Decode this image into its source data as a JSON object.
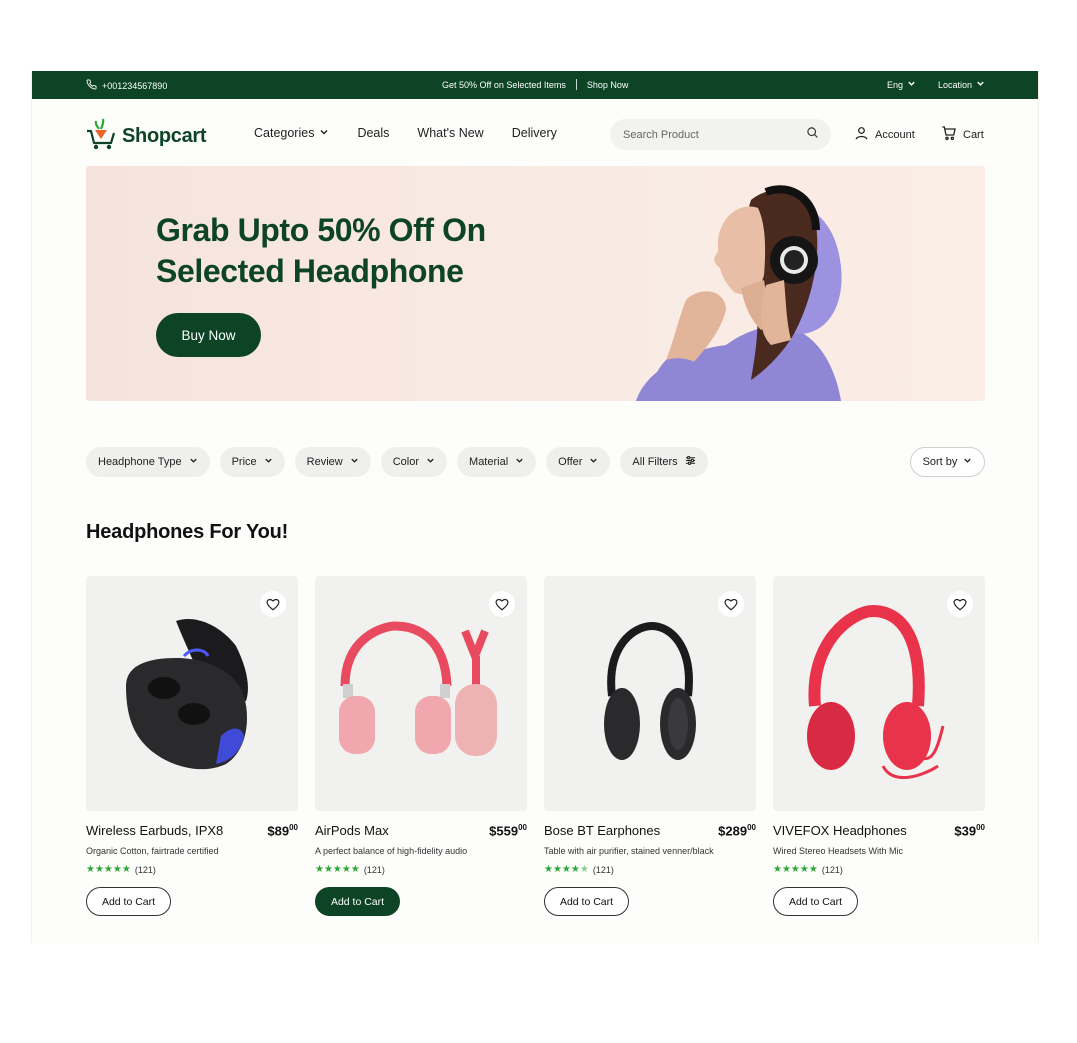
{
  "topbar": {
    "phone": "+001234567890",
    "promo": "Get 50% Off on Selected Items",
    "shop_now": "Shop Now",
    "language": "Eng",
    "location": "Location"
  },
  "header": {
    "logo": "Shopcart",
    "nav": [
      "Categories",
      "Deals",
      "What's New",
      "Delivery"
    ],
    "search_placeholder": "Search Product",
    "account": "Account",
    "cart": "Cart"
  },
  "hero": {
    "headline_line1": "Grab Upto 50% Off On",
    "headline_line2": "Selected Headphone",
    "button": "Buy Now"
  },
  "filters": [
    "Headphone Type",
    "Price",
    "Review",
    "Color",
    "Material",
    "Offer",
    "All Filters"
  ],
  "sort_label": "Sort by",
  "section_title": "Headphones For You!",
  "products": [
    {
      "name": "Wireless Earbuds, IPX8",
      "price_main": "$89",
      "price_cents": "00",
      "desc": "Organic Cotton, fairtrade certified",
      "stars": 5,
      "reviews": "(121)",
      "button": "Add to Cart"
    },
    {
      "name": "AirPods Max",
      "price_main": "$559",
      "price_cents": "00",
      "desc": "A perfect balance of high-fidelity audio",
      "stars": 5,
      "reviews": "(121)",
      "button": "Add to Cart"
    },
    {
      "name": "Bose BT Earphones",
      "price_main": "$289",
      "price_cents": "00",
      "desc": "Table with air purifier, stained venner/black",
      "stars": 4.5,
      "reviews": "(121)",
      "button": "Add to Cart"
    },
    {
      "name": "VIVEFOX Headphones",
      "price_main": "$39",
      "price_cents": "00",
      "desc": "Wired Stereo Headsets With Mic",
      "stars": 5,
      "reviews": "(121)",
      "button": "Add to Cart"
    }
  ],
  "colors": {
    "brand": "#0d4426",
    "star": "#2da836",
    "hero_bg": "#f6e4dc"
  }
}
